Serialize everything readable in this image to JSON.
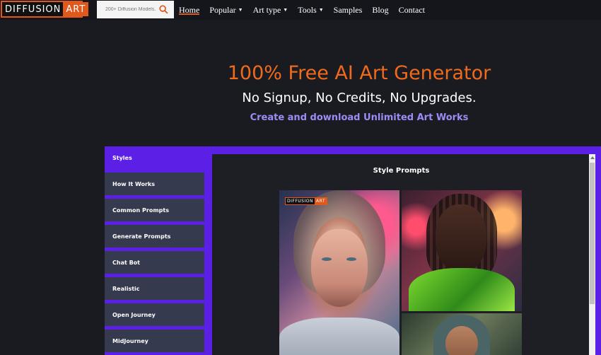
{
  "header": {
    "logo_left": "DIFFUSION",
    "logo_right": "ART",
    "search_placeholder": "200+ Diffusion Models...",
    "nav": [
      {
        "label": "Home",
        "caret": false,
        "active": true
      },
      {
        "label": "Popular",
        "caret": true,
        "active": false
      },
      {
        "label": "Art type",
        "caret": true,
        "active": false
      },
      {
        "label": "Tools",
        "caret": true,
        "active": false
      },
      {
        "label": "Samples",
        "caret": false,
        "active": false
      },
      {
        "label": "Blog",
        "caret": false,
        "active": false
      },
      {
        "label": "Contact",
        "caret": false,
        "active": false
      }
    ]
  },
  "hero": {
    "title": "100% Free AI Art Generator",
    "subtitle": "No Signup, No Credits, No Upgrades.",
    "cta": "Create and download Unlimited Art Works"
  },
  "tabs": [
    {
      "label": "Styles",
      "active": true
    },
    {
      "label": "How It Works",
      "active": false
    },
    {
      "label": "Common Prompts",
      "active": false
    },
    {
      "label": "Generate Prompts",
      "active": false
    },
    {
      "label": "Chat Bot",
      "active": false
    },
    {
      "label": "Realistic",
      "active": false
    },
    {
      "label": "Open Journey",
      "active": false
    },
    {
      "label": "MidJourney",
      "active": false
    }
  ],
  "content": {
    "title": "Style Prompts",
    "watermark_left": "DIFFUSION",
    "watermark_right": "ART"
  },
  "colors": {
    "accent": "#e0581b",
    "title_orange": "#ef6a1d",
    "purple": "#5b1fe6",
    "link_lavender": "#9c8cf5",
    "tab_bg": "#353a4e"
  },
  "icons": {
    "search": "search-icon",
    "caret": "chevron-down-icon"
  }
}
